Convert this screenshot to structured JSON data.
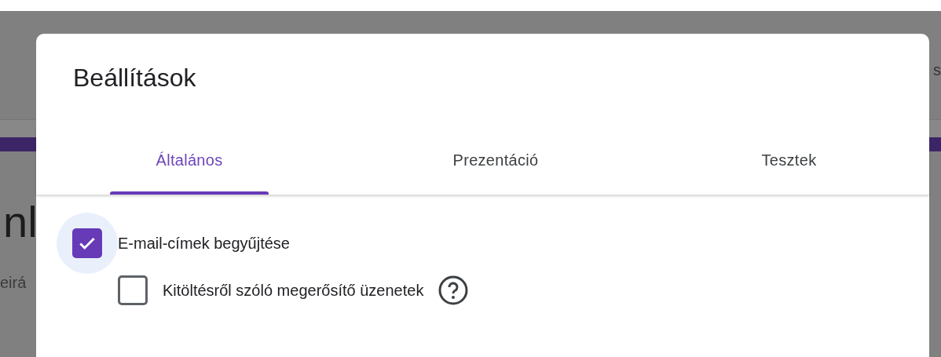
{
  "background": {
    "heading_fragment": "nl",
    "description_fragment": "eirá",
    "right_fragment": "s"
  },
  "dialog": {
    "title": "Beállítások",
    "tabs": [
      {
        "label": "Általános",
        "selected": true
      },
      {
        "label": "Prezentáció",
        "selected": false
      },
      {
        "label": "Tesztek",
        "selected": false
      }
    ],
    "options": [
      {
        "label": "E-mail-címek begyűjtése",
        "checked": true,
        "focused": true,
        "help": false,
        "children": [
          {
            "label": "Kitöltésről szóló megerősítő üzenetek",
            "checked": false,
            "focused": false,
            "help": true
          }
        ]
      }
    ]
  }
}
